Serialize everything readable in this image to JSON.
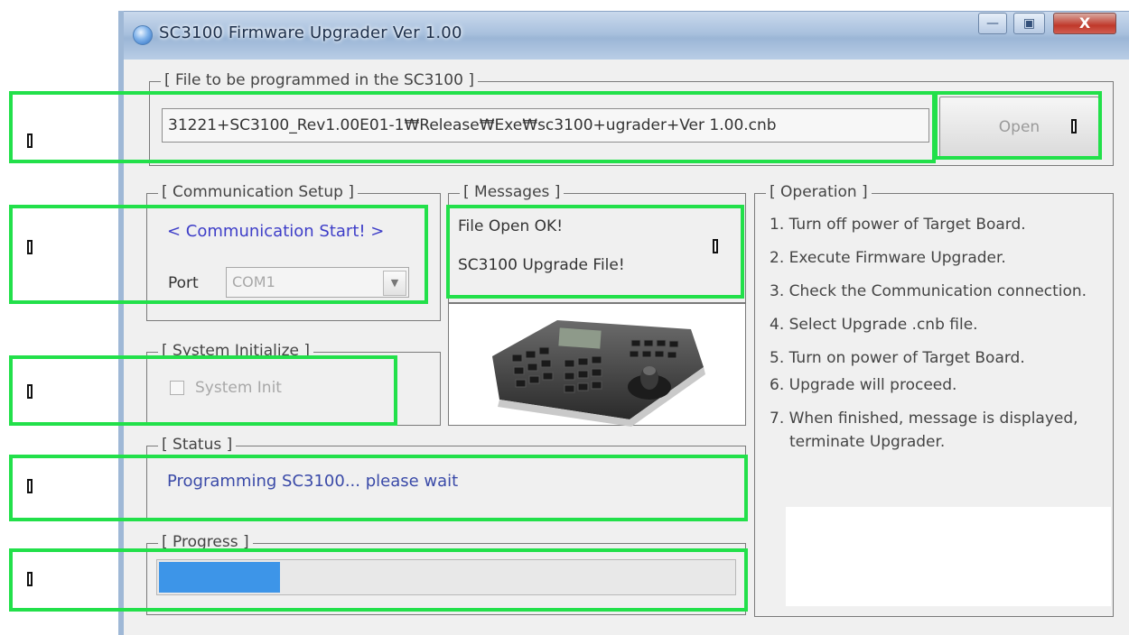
{
  "window": {
    "title": "SC3100 Firmware Upgrader Ver 1.00",
    "controls": {
      "minimize": "—",
      "maximize": "▣",
      "close": "X"
    }
  },
  "file_group": {
    "title": "[ File to be programmed in the SC3100 ]",
    "path": "31221+SC3100_Rev1.00E01-1₩Release₩Exe₩sc3100+ugrader+Ver 1.00.cnb",
    "open_button": "Open"
  },
  "communication": {
    "title": "[ Communication Setup ]",
    "start_link": "< Communication Start! >",
    "port_label": "Port",
    "port_value": "COM1"
  },
  "messages": {
    "title": "[ Messages ]",
    "lines": [
      "File Open OK!",
      "SC3100 Upgrade File!"
    ]
  },
  "system_init": {
    "title": "[ System Initialize ]",
    "checkbox_label": "System Init",
    "checked": false
  },
  "status": {
    "title": "[ Status ]",
    "text": "Programming SC3100... please wait"
  },
  "progress": {
    "title": "[ Progress ]",
    "value_fraction": 0.21
  },
  "operation": {
    "title": "[ Operation ]",
    "steps": [
      "1. Turn off power of Target Board.",
      "2. Execute Firmware Upgrader.",
      "3. Check the Communication connection.",
      "4. Select Upgrade .cnb file.",
      "5. Turn on power of Target Board.",
      "6. Upgrade will proceed.",
      "7. When finished, message is displayed, terminate Upgrader."
    ]
  },
  "annotation_color": "#22e04a",
  "progress_color": "#3d95e8",
  "link_color": "#3e3ec8"
}
